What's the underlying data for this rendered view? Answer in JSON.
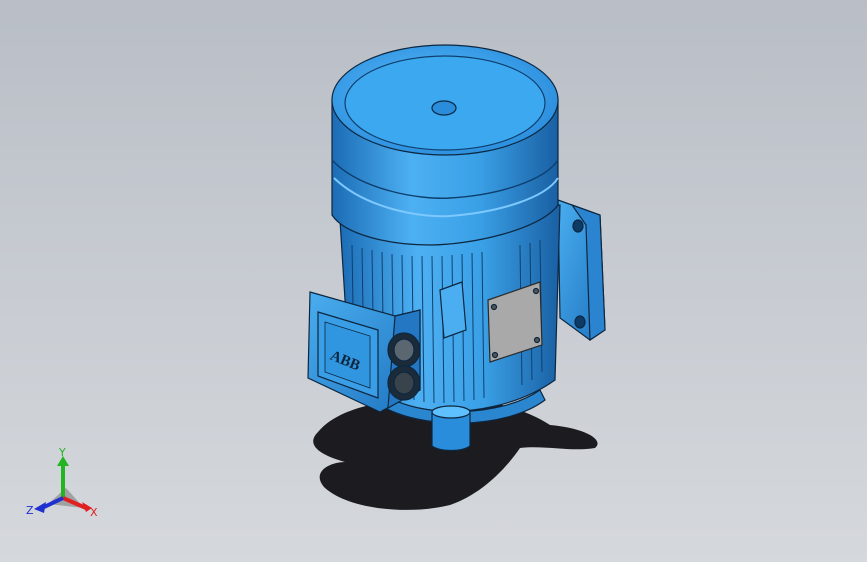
{
  "app": {
    "window_title": ""
  },
  "model": {
    "name": "",
    "nameplate_logo": "ABB",
    "colors": {
      "body": "#3aa3ea",
      "body_dark": "#1e6fb8",
      "body_light": "#7cc8ff",
      "outline": "#0d2740",
      "plate": "#a9a9a9",
      "shadow": "#0f0f14",
      "background_top": "#b9bec6",
      "background_bottom": "#d5d8dc"
    }
  },
  "triad": {
    "x_label": "X",
    "y_label": "Y",
    "z_label": "Z",
    "colors": {
      "x": "#e02020",
      "y": "#22b422",
      "z": "#2030d0"
    }
  }
}
